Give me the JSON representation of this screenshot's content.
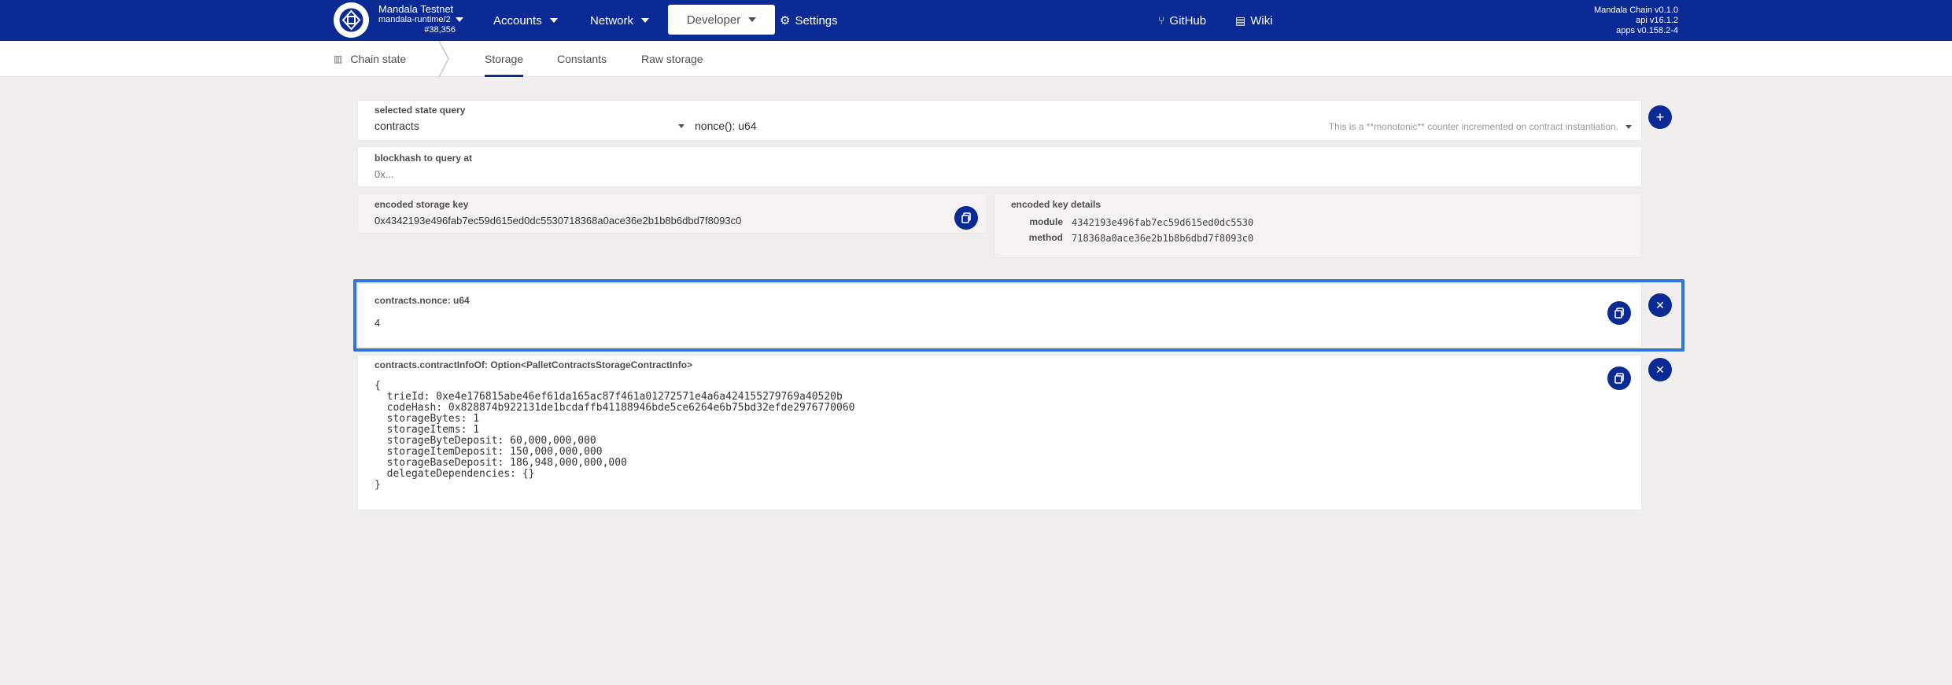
{
  "header": {
    "chain_name": "Mandala Testnet",
    "runtime": "mandala-runtime/2",
    "block": "#38,356",
    "nav": {
      "accounts": "Accounts",
      "network": "Network",
      "developer": "Developer",
      "settings": "Settings",
      "github": "GitHub",
      "wiki": "Wiki"
    },
    "versions": {
      "chain": "Mandala Chain v0.1.0",
      "api": "api v16.1.2",
      "apps": "apps v0.158.2-4"
    }
  },
  "subnav": {
    "title": "Chain state",
    "tabs": [
      "Storage",
      "Constants",
      "Raw storage"
    ],
    "active_tab": "Storage"
  },
  "query": {
    "label": "selected state query",
    "module": "contracts",
    "method": "nonce(): u64",
    "description": "This is a **monotonic** counter incremented on contract instantiation."
  },
  "blockhash": {
    "label": "blockhash to query at",
    "placeholder": "0x..."
  },
  "encoded_key": {
    "label": "encoded storage key",
    "value": "0x4342193e496fab7ec59d615ed0dc5530718368a0ace36e2b1b8b6dbd7f8093c0"
  },
  "key_details": {
    "label": "encoded key details",
    "module_label": "module",
    "module_value": "4342193e496fab7ec59d615ed0dc5530",
    "method_label": "method",
    "method_value": "718368a0ace36e2b1b8b6dbd7f8093c0"
  },
  "results": [
    {
      "label": "contracts.nonce: u64",
      "value": "4"
    },
    {
      "label": "contracts.contractInfoOf: Option<PalletContractsStorageContractInfo>",
      "value": "{\n  trieId: 0xe4e176815abe46ef61da165ac87f461a01272571e4a6a424155279769a40520b\n  codeHash: 0x828874b922131de1bcdaffb41188946bde5ce6264e6b75bd32efde2976770060\n  storageBytes: 1\n  storageItems: 1\n  storageByteDeposit: 60,000,000,000\n  storageItemDeposit: 150,000,000,000\n  storageBaseDeposit: 186,948,000,000,000\n  delegateDependencies: {}\n}"
    }
  ],
  "colors": {
    "brand": "#0b2a93",
    "highlight": "#2f74d8",
    "background": "#f0efee"
  }
}
